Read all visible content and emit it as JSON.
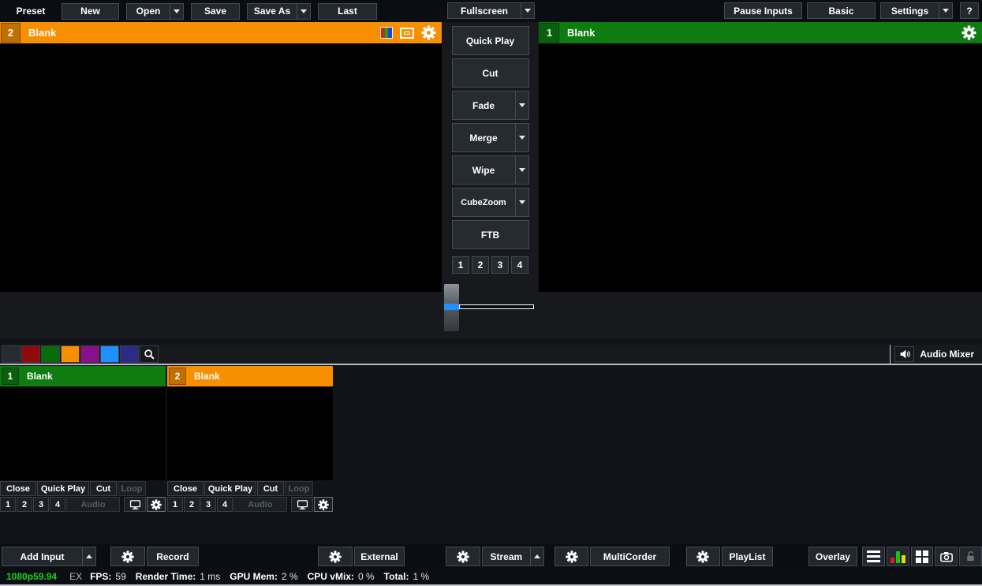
{
  "colors": {
    "accent_orange": "#F78F00",
    "accent_green": "#0E7C10",
    "tbar_blue": "#1E90FF",
    "status_green": "#17D417",
    "button_bg": "#23272e",
    "button_border": "#454b54"
  },
  "topbar": {
    "preset_label": "Preset",
    "new": "New",
    "open": "Open",
    "save": "Save",
    "save_as": "Save As",
    "last": "Last",
    "fullscreen": "Fullscreen",
    "pause_inputs": "Pause Inputs",
    "basic": "Basic",
    "settings": "Settings",
    "help": "?"
  },
  "preview": {
    "number": "2",
    "title": "Blank"
  },
  "program": {
    "number": "1",
    "title": "Blank"
  },
  "transitions": {
    "quick_play": "Quick Play",
    "cut": "Cut",
    "fade": "Fade",
    "merge": "Merge",
    "wipe": "Wipe",
    "cubezoom": "CubeZoom",
    "ftb": "FTB",
    "stingers": [
      "1",
      "2",
      "3",
      "4"
    ]
  },
  "mixbar": {
    "audio_mixer": "Audio Mixer",
    "swatches": [
      "#8F0A0A",
      "#0A6B0A",
      "#F78F00",
      "#8A0F8A",
      "#1E90FF",
      "#2C2C86"
    ]
  },
  "inputs": [
    {
      "number": "1",
      "title": "Blank"
    },
    {
      "number": "2",
      "title": "Blank"
    }
  ],
  "input_controls": {
    "close": "Close",
    "quick_play": "Quick Play",
    "cut": "Cut",
    "loop": "Loop",
    "numbers": [
      "1",
      "2",
      "3",
      "4"
    ],
    "audio": "Audio"
  },
  "bottombar": {
    "add_input": "Add Input",
    "record": "Record",
    "external": "External",
    "stream": "Stream",
    "multicorder": "MultiCorder",
    "playlist": "PlayList",
    "overlay": "Overlay"
  },
  "statusbar": {
    "resolution": "1080p59.94",
    "ex": "EX",
    "fps_label": "FPS:",
    "fps_value": "59",
    "render_label": "Render Time:",
    "render_value": "1 ms",
    "gpu_label": "GPU Mem:",
    "gpu_value": "2 %",
    "cpu_label": "CPU vMix:",
    "cpu_value": "0 %",
    "total_label": "Total:",
    "total_value": "1 %"
  }
}
